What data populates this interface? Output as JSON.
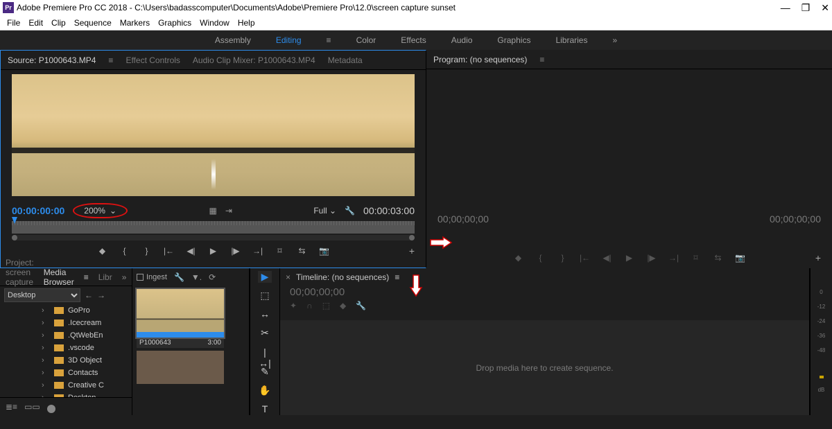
{
  "titlebar": {
    "app_icon_label": "Pr",
    "title": "Adobe Premiere Pro CC 2018 - C:\\Users\\badasscomputer\\Documents\\Adobe\\Premiere Pro\\12.0\\screen capture sunset",
    "min": "—",
    "max": "❐",
    "close": "✕"
  },
  "menubar": [
    "File",
    "Edit",
    "Clip",
    "Sequence",
    "Markers",
    "Graphics",
    "Window",
    "Help"
  ],
  "workspaces": {
    "items": [
      "Assembly",
      "Editing",
      "Color",
      "Effects",
      "Audio",
      "Graphics",
      "Libraries"
    ],
    "active_index": 1,
    "menu_glyph": "≡",
    "overflow_glyph": "»"
  },
  "source": {
    "tabs": [
      "Source: P1000643.MP4",
      "Effect Controls",
      "Audio Clip Mixer: P1000643.MP4",
      "Metadata"
    ],
    "active_tab": 0,
    "menu_glyph": "≡",
    "timecode_current": "00:00:00:00",
    "zoom_value": "200%",
    "zoom_chev": "⌄",
    "fit_label": "Full",
    "fit_chev": "⌄",
    "wrench": "🔧",
    "timecode_duration": "00:00:03:00",
    "small_icons": {
      "a": "▦",
      "b": "⇥"
    },
    "transport_icons": [
      "◆",
      "{",
      "}",
      "|←",
      "◀|",
      "▶",
      "|▶",
      "→|",
      "⌑",
      "⇆",
      "📷"
    ],
    "plus": "+"
  },
  "program": {
    "title": "Program: (no sequences)",
    "menu_glyph": "≡",
    "timecode_left": "00;00;00;00",
    "timecode_right": "00;00;00;00",
    "transport_icons": [
      "◆",
      "{",
      "}",
      "|←",
      "◀|",
      "▶",
      "|▶",
      "→|",
      "⌑",
      "⇆",
      "📷"
    ],
    "plus": "+"
  },
  "project": {
    "tabs": [
      "Project: screen capture sunset",
      "Media Browser",
      "Libr"
    ],
    "active_tab": 1,
    "menu_glyph": "≡",
    "overflow": "»",
    "desktop_dropdown": "Desktop",
    "nav_back": "←",
    "nav_fwd": "→",
    "ingest_label": "Ingest",
    "toolbar_icons": [
      "🔧",
      "▼.",
      "⟳"
    ],
    "folders": [
      "GoPro",
      ".Icecream",
      ".QtWebEn",
      ".vscode",
      "3D Object",
      "Contacts",
      "Creative C",
      "Desktop"
    ],
    "clip": {
      "name": "P1000643",
      "duration": "3:00"
    },
    "bottom_icons": [
      "≣≡",
      "▭▭",
      "◯"
    ]
  },
  "toolbox": {
    "tools": [
      "▶",
      "⬚",
      "↔",
      "✂",
      "|↔|",
      "✎",
      "✋",
      "T"
    ]
  },
  "timeline": {
    "close_glyph": "×",
    "title": "Timeline: (no sequences)",
    "menu_glyph": "≡",
    "timecode": "00;00;00;00",
    "icons": [
      "✦",
      "∩",
      "⬚",
      "◆",
      "🔧"
    ],
    "drop_hint": "Drop media here to create sequence."
  },
  "meters": {
    "labels": [
      "0",
      "-12",
      "-24",
      "-36",
      "-48",
      "dB"
    ]
  }
}
